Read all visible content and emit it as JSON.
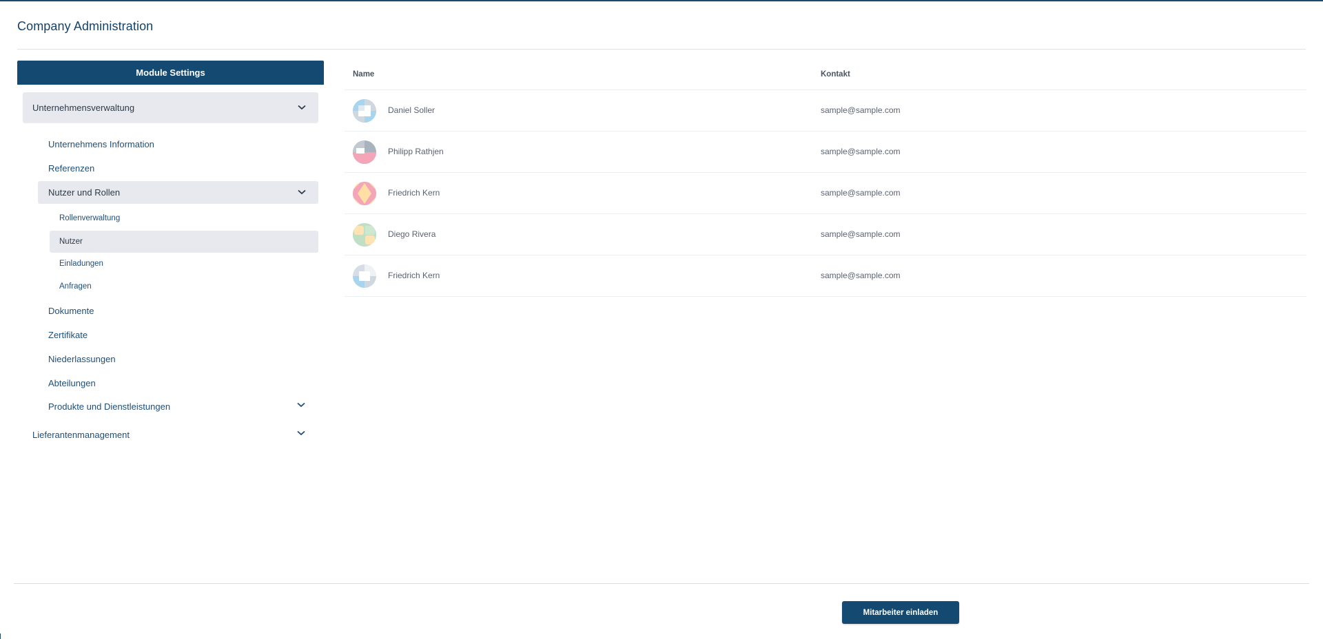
{
  "page": {
    "title": "Company Administration"
  },
  "sidebar": {
    "header": "Module Settings",
    "group": {
      "label": "Unternehmensverwaltung",
      "items": [
        {
          "label": "Unternehmens Information"
        },
        {
          "label": "Referenzen"
        }
      ],
      "subgroup": {
        "label": "Nutzer und Rollen",
        "items": [
          {
            "label": "Rollenverwaltung"
          },
          {
            "label": "Nutzer"
          },
          {
            "label": "Einladungen"
          },
          {
            "label": "Anfragen"
          }
        ]
      },
      "items_after": [
        {
          "label": "Dokumente"
        },
        {
          "label": "Zertifikate"
        },
        {
          "label": "Niederlassungen"
        },
        {
          "label": "Abteilungen"
        },
        {
          "label": "Produkte und Dienstleistungen"
        }
      ]
    },
    "group2": {
      "label": "Lieferantenmanagement"
    }
  },
  "table": {
    "columns": [
      "Name",
      "Kontakt"
    ],
    "rows": [
      {
        "name": "Daniel Soller",
        "contact": "sample@sample.com"
      },
      {
        "name": "Philipp Rathjen",
        "contact": "sample@sample.com"
      },
      {
        "name": "Friedrich Kern",
        "contact": "sample@sample.com"
      },
      {
        "name": "Diego Rivera",
        "contact": "sample@sample.com"
      },
      {
        "name": "Friedrich Kern",
        "contact": "sample@sample.com"
      }
    ]
  },
  "footer": {
    "invite_label": "Mitarbeiter einladen"
  },
  "colors": {
    "primary": "#144a71",
    "accent_text": "#1f4e79",
    "panel_bg": "#e7e9ef"
  }
}
